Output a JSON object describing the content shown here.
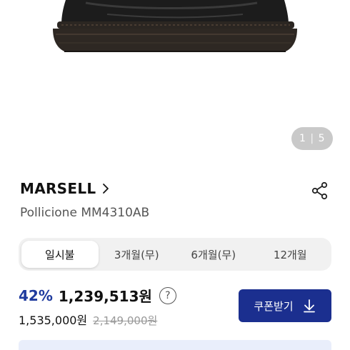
{
  "gallery": {
    "image_name": "shoe-image",
    "counter_current": "1",
    "counter_total": "5"
  },
  "product": {
    "brand": "MARSELL",
    "model": "Pollicione MM4310AB"
  },
  "plans": [
    {
      "label": "일시불",
      "active": true
    },
    {
      "label": "3개월(무)",
      "active": false
    },
    {
      "label": "6개월(무)",
      "active": false
    },
    {
      "label": "12개월",
      "active": false
    }
  ],
  "pricing": {
    "discount": "42%",
    "price": "1,239,513원",
    "help": "?",
    "sub_price": "1,535,000원",
    "original_price": "2,149,000원"
  },
  "coupon": {
    "label": "쿠폰받기"
  },
  "banner": {
    "text": ""
  },
  "colors": {
    "accent": "#1f3b9e",
    "button": "#1b2f8f",
    "banner": "#e9eefb"
  }
}
